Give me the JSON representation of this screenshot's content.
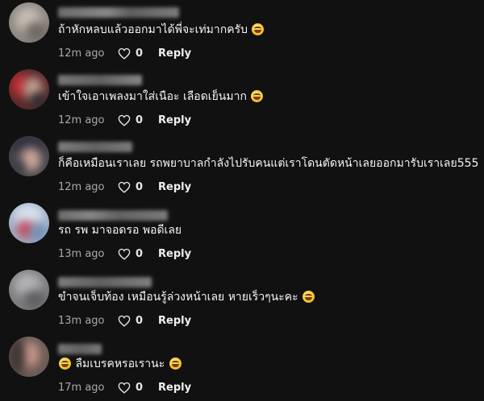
{
  "comments": [
    {
      "text": "ถ้าหักหลบแล้วออกมาได้พี่จะเท่มากครับ",
      "emoji": "laughing-tears-emoji",
      "time": "12m ago",
      "likes": "0",
      "reply_label": "Reply"
    },
    {
      "text": "เข้าใจเอาเพลงมาใส่เนือะ เลือดเย็นมาก",
      "emoji": "laughing-tears-emoji",
      "time": "12m ago",
      "likes": "0",
      "reply_label": "Reply"
    },
    {
      "text": "ก็คือเหมือนเราเลย รถพยาบาลกำลังไปรับคนแต่เราโดนตัดหน้าเลยออกมารับเราเลย555",
      "time": "12m ago",
      "likes": "0",
      "reply_label": "Reply"
    },
    {
      "text": "รถ รพ มาจอดรอ พอดีเลย",
      "time": "13m ago",
      "likes": "0",
      "reply_label": "Reply"
    },
    {
      "text": "ขำจนเจ็บท้อง เหมือนรู้ล่วงหน้าเลย หายเร็วๆนะคะ",
      "emoji": "laughing-tears-emoji",
      "time": "13m ago",
      "likes": "0",
      "reply_label": "Reply"
    },
    {
      "text": "ลืมเบรคหรอเรานะ",
      "emoji": "laughing-tears-emoji",
      "time": "17m ago",
      "likes": "0",
      "reply_label": "Reply"
    }
  ],
  "colors": {
    "background": "#111111",
    "text": "#f4f4f4",
    "timestamp": "#a8a8a8",
    "emoji": "#f7c52f"
  },
  "icons": {
    "like": "heart-outline-icon"
  }
}
